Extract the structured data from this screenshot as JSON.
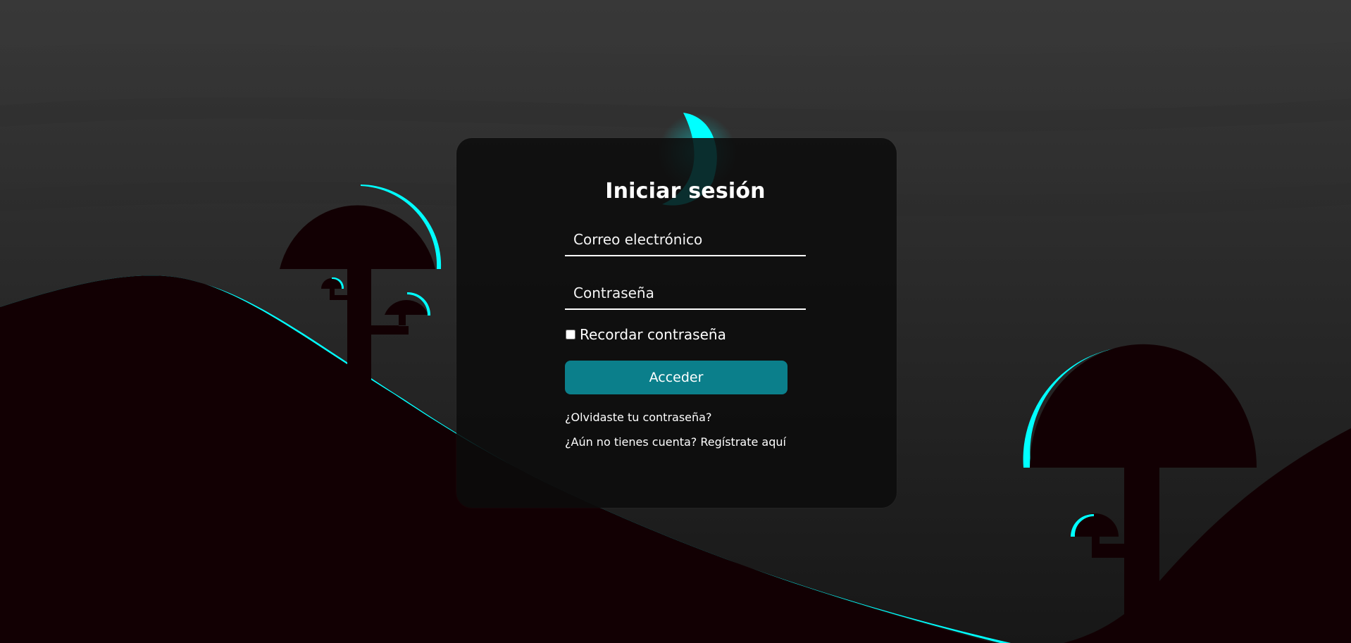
{
  "login": {
    "title": "Iniciar sesión",
    "email_placeholder": "Correo electrónico",
    "password_placeholder": "Contraseña",
    "remember_label": "Recordar contraseña",
    "submit_label": "Acceder",
    "forgot_link": "¿Olvidaste tu contraseña?",
    "register_link": "¿Aún no tienes cuenta? Regístrate aquí"
  },
  "colors": {
    "accent": "#00ffff",
    "button": "#0b7f8b",
    "silhouette": "#120003",
    "background": "#1c1c1c"
  }
}
